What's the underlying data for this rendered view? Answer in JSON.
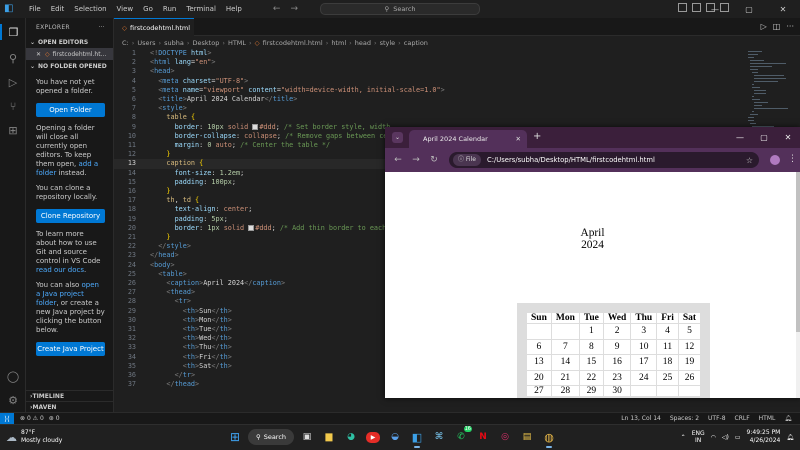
{
  "titlebar": {
    "menu": [
      "File",
      "Edit",
      "Selection",
      "View",
      "Go",
      "Run",
      "Terminal",
      "Help"
    ],
    "search_placeholder": "Search"
  },
  "sidebar": {
    "title": "EXPLORER",
    "open_editors_label": "OPEN EDITORS",
    "open_file": "firstcodehtml.ht...",
    "no_folder_label": "NO FOLDER OPENED",
    "msg1": "You have not yet opened a folder.",
    "open_folder_btn": "Open Folder",
    "msg2_a": "Opening a folder will close all currently open editors. To keep them open,",
    "msg2_link": "add a folder",
    "msg2_b": "instead.",
    "msg3": "You can clone a repository locally.",
    "clone_btn": "Clone Repository",
    "msg4_a": "To learn more about how to use Git and source control in VS Code",
    "msg4_link": "read our docs",
    "msg4_b": ".",
    "msg5_a": "You can also",
    "msg5_link": "open a Java project folder",
    "msg5_b": ", or create a new Java project by clicking the button below.",
    "java_btn": "Create Java Project",
    "timeline_label": "TIMELINE",
    "maven_label": "MAVEN"
  },
  "editor": {
    "tab_label": "firstcodehtml.html",
    "breadcrumb": [
      "C:",
      "Users",
      "subha",
      "Desktop",
      "HTML",
      "firstcodehtml.html",
      "html",
      "head",
      "style",
      "caption"
    ],
    "line_numbers": [
      "1",
      "2",
      "3",
      "4",
      "5",
      "6",
      "7",
      "8",
      "9",
      "10",
      "11",
      "12",
      "13",
      "14",
      "15",
      "16",
      "17",
      "18",
      "19",
      "20",
      "21",
      "22",
      "23",
      "24",
      "25",
      "26",
      "27",
      "28",
      "29",
      "30",
      "31",
      "32",
      "33",
      "34",
      "35",
      "36",
      "37"
    ],
    "current_line": "13"
  },
  "browser": {
    "tab_title": "April 2024 Calendar",
    "url_chip": "File",
    "url": "C:/Users/subha/Desktop/HTML/firstcodehtml.html"
  },
  "calendar": {
    "caption": "April 2024",
    "headers": [
      "Sun",
      "Mon",
      "Tue",
      "Wed",
      "Thu",
      "Fri",
      "Sat"
    ],
    "rows": [
      [
        "",
        "",
        "1",
        "2",
        "3",
        "4",
        "5"
      ],
      [
        "6",
        "7",
        "8",
        "9",
        "10",
        "11",
        "12"
      ],
      [
        "13",
        "14",
        "15",
        "16",
        "17",
        "18",
        "19"
      ],
      [
        "20",
        "21",
        "22",
        "23",
        "24",
        "25",
        "26"
      ],
      [
        "27",
        "28",
        "29",
        "30",
        "",
        "",
        ""
      ]
    ]
  },
  "statusbar": {
    "problems": "0 ⚠ 0",
    "ports": "0",
    "position": "Ln 13, Col 14",
    "spaces": "Spaces: 2",
    "encoding": "UTF-8",
    "eol": "CRLF",
    "language": "HTML"
  },
  "taskbar": {
    "temperature": "87°F",
    "weather": "Mostly cloudy",
    "search_label": "Search",
    "whatsapp_badge": "16",
    "lang_top": "ENG",
    "lang_bottom": "IN",
    "time": "9:49:25 PM",
    "date": "4/26/2024"
  }
}
